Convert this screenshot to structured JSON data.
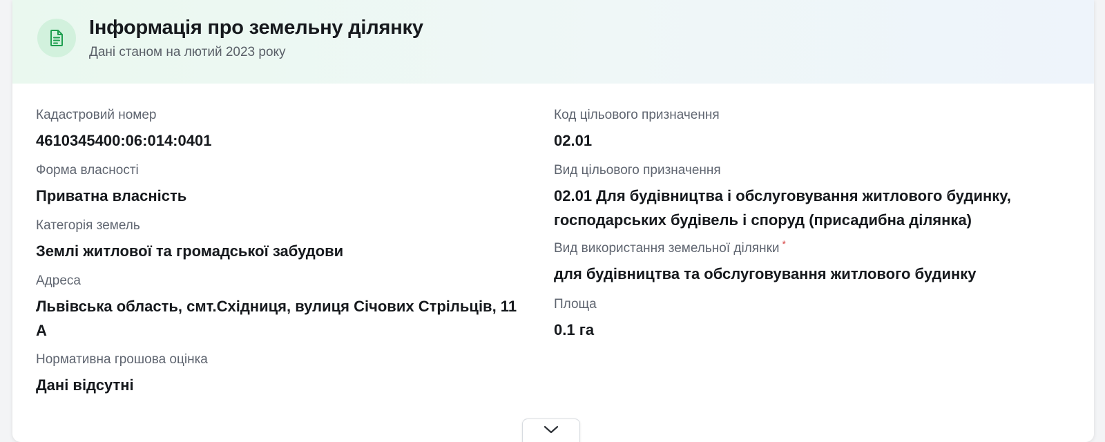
{
  "header": {
    "icon": "document-icon",
    "title": "Інформація про земельну ділянку",
    "subtitle": "Дані станом на лютий 2023 року"
  },
  "left_fields": [
    {
      "label": "Кадастровий номер",
      "value": "4610345400:06:014:0401"
    },
    {
      "label": "Форма власності",
      "value": "Приватна власність"
    },
    {
      "label": "Категорія земель",
      "value": "Землі житлової та громадської забудови"
    },
    {
      "label": "Адреса",
      "value": "Львівська область, смт.Східниця, вулиця Січових Стрільців, 11 А"
    },
    {
      "label": "Нормативна грошова оцінка",
      "value": "Дані відсутні"
    }
  ],
  "right_fields": [
    {
      "label": "Код цільового призначення",
      "value": "02.01"
    },
    {
      "label": "Вид цільового призначення",
      "value": "02.01 Для будівництва і обслуговування житлового будинку, господарських будівель і споруд (присадибна ділянка)"
    },
    {
      "label": "Вид використання земельної ділянки",
      "required_mark": "*",
      "value": "для будівництва та обслуговування житлового будинку"
    },
    {
      "label": "Площа",
      "value": "0.1 га"
    }
  ],
  "expand_button": {
    "icon": "chevron-down-icon"
  },
  "colors": {
    "accent_green": "#1e9e4f",
    "icon_circle": "#d2f1dd",
    "required_red": "#d43b3b"
  }
}
